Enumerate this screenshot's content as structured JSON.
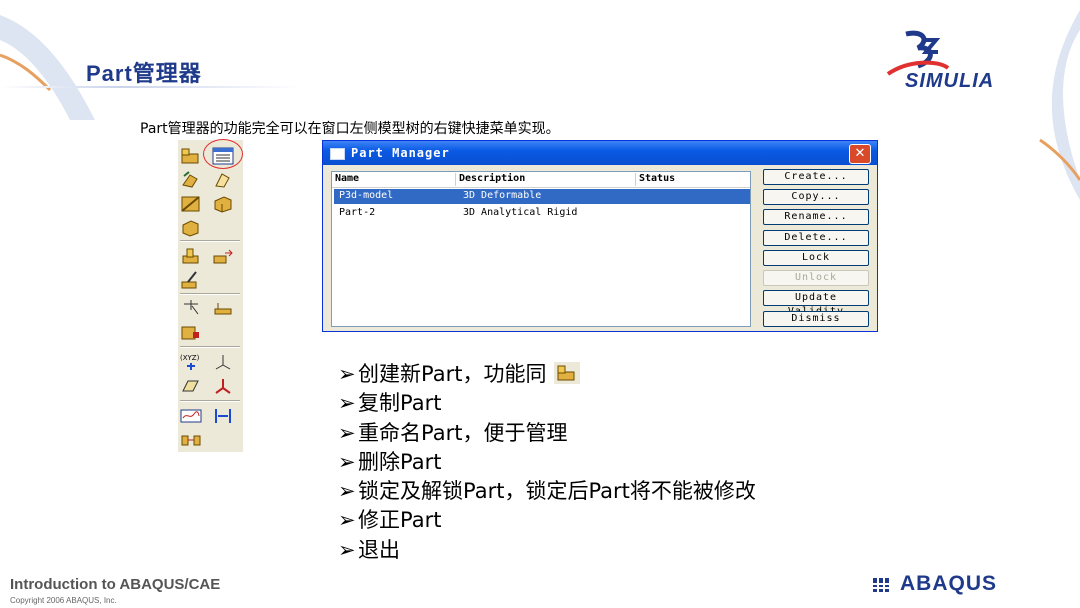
{
  "slide": {
    "title": "Part管理器",
    "subtitle": "Part管理器的功能完全可以在窗口左侧模型树的右键快捷菜单实现。"
  },
  "logo": {
    "text": "SIMULIA"
  },
  "dialog": {
    "title": "Part Manager",
    "close_label": "✕",
    "columns": [
      "Name",
      "Description",
      "Status"
    ],
    "rows": [
      {
        "name": "P3d-model",
        "description": "3D Deformable",
        "status": "",
        "selected": true
      },
      {
        "name": "Part-2",
        "description": "3D Analytical Rigid",
        "status": "",
        "selected": false
      }
    ],
    "buttons": {
      "create": "Create...",
      "copy": "Copy...",
      "rename": "Rename...",
      "delete": "Delete...",
      "lock": "Lock",
      "unlock": "Unlock",
      "update_validity": "Update Validity",
      "dismiss": "Dismiss"
    }
  },
  "bullets": {
    "arrow": "➢",
    "create": "创建新Part，功能同",
    "copy": "复制Part",
    "rename": "重命名Part，便于管理",
    "delete": "删除Part",
    "lock": "锁定及解锁Part，锁定后Part将不能被修改",
    "edit": "修正Part",
    "exit": "退出"
  },
  "footer": {
    "course": "Introduction to ABAQUS/CAE",
    "copyright": "Copyright 2006 ABAQUS, Inc.",
    "brand": "ABAQUS"
  },
  "colors": {
    "title": "#1f3a8a",
    "selection": "#316ac5",
    "titlebar": "#0a5ae4",
    "highlight_circle": "#e03030"
  }
}
